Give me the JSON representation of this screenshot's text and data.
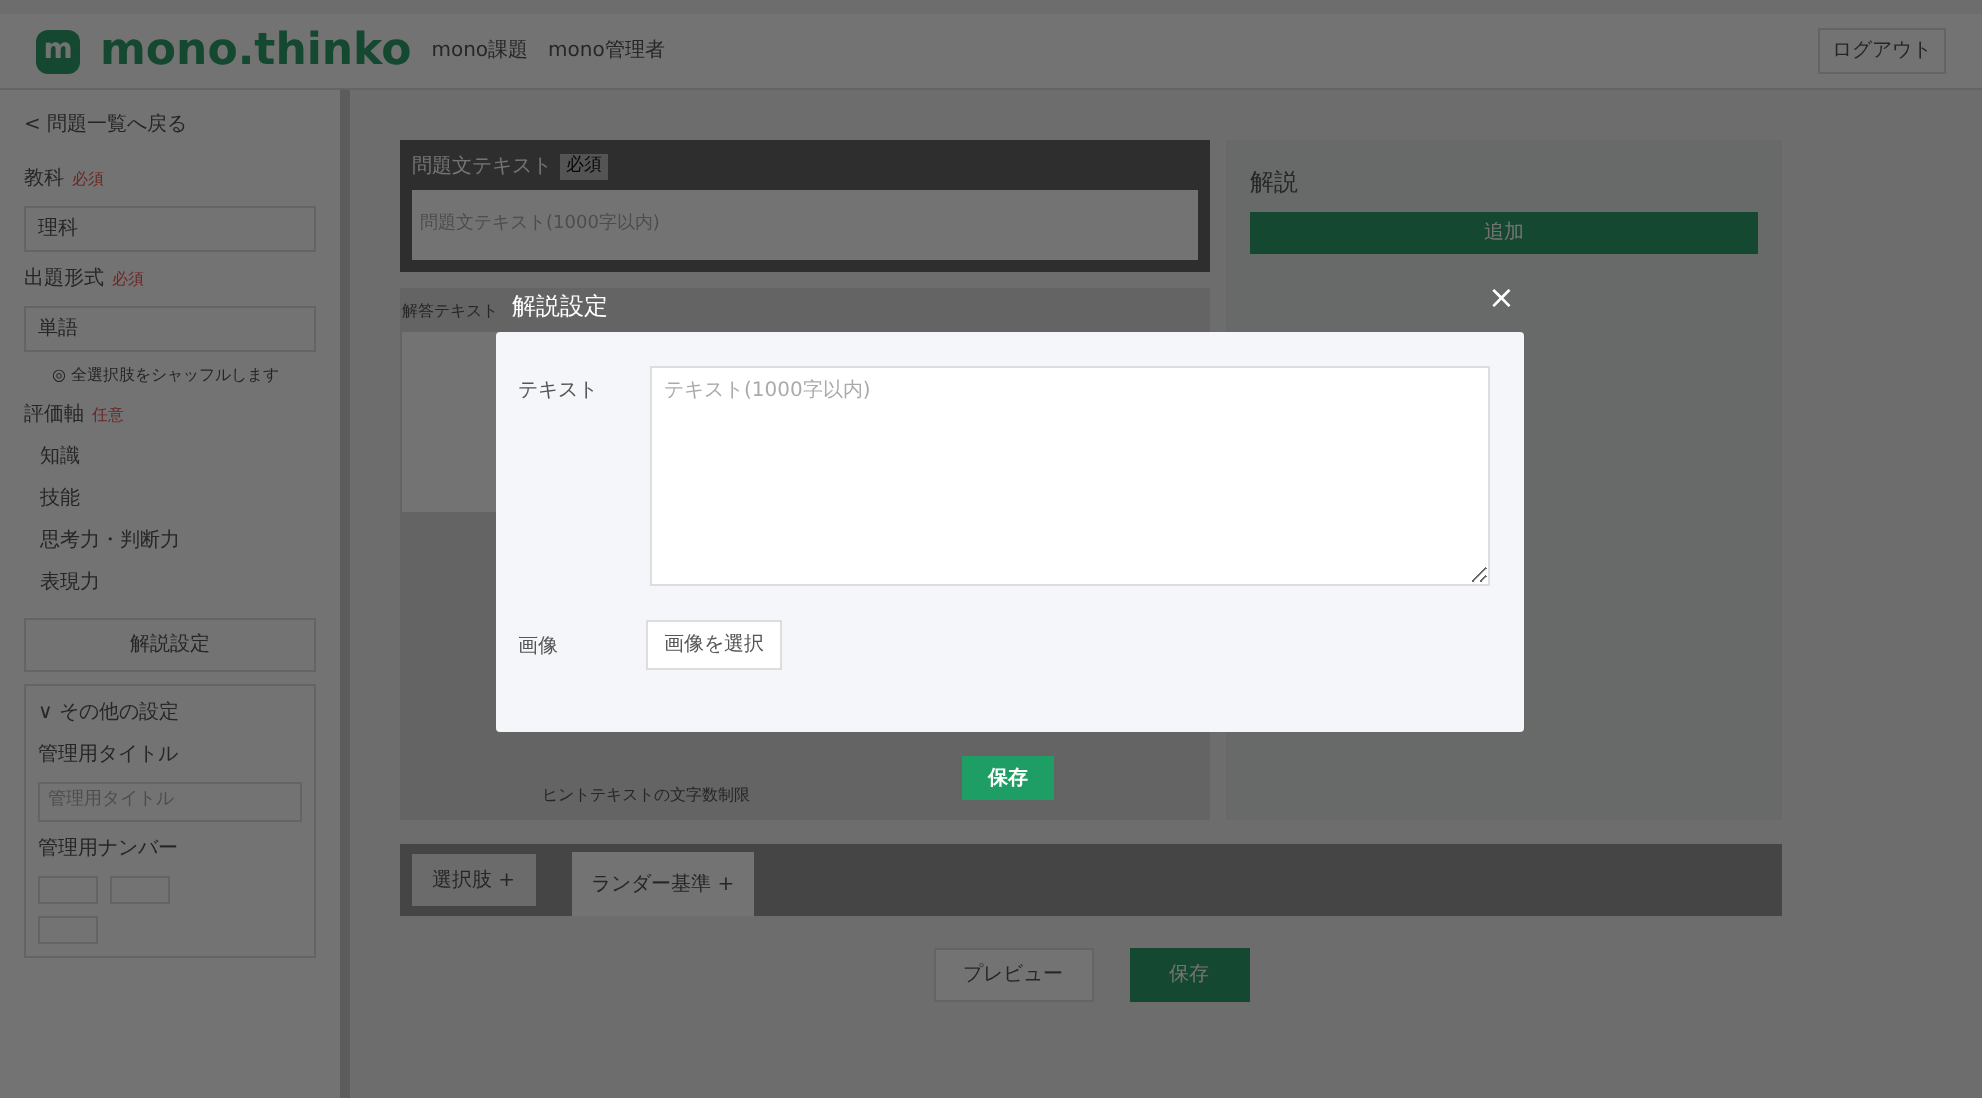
{
  "header": {
    "logo_mark": "m",
    "logo": "mono.thinko",
    "nav": [
      "mono課題",
      "mono管理者"
    ],
    "logout": "ログアウト"
  },
  "sidebar": {
    "back": "< 問題一覧へ戻る",
    "fields": [
      {
        "label": "教科",
        "badge": "必須",
        "value": "理科"
      },
      {
        "label": "出題形式",
        "badge": "必須",
        "value": "単語",
        "note": "◎ 全選択肢をシャッフルします"
      }
    ],
    "axis": {
      "label": "評価軸",
      "badge": "任意",
      "items": [
        "知識",
        "技能",
        "思考力・判断力",
        "表現力"
      ]
    },
    "explain_button": "解説設定",
    "other": {
      "title": "∨ その他の設定",
      "fields": [
        {
          "label": "管理用タイトル",
          "placeholder": "管理用タイトル"
        },
        {
          "label": "管理用ナンバー"
        }
      ]
    }
  },
  "main": {
    "question": {
      "title": "問題文テキスト",
      "badge": "必須",
      "placeholder": "問題文テキスト(1000字以内)"
    },
    "answer": {
      "title": "解答テキスト",
      "caption": "ヒントテキストの文字数制限"
    },
    "side": {
      "title": "解説",
      "add": "追加"
    },
    "tabs": [
      {
        "label": "選択肢 +",
        "selected": false
      },
      {
        "label": "ランダー基準 +",
        "selected": true
      }
    ],
    "preview": "プレビュー",
    "save": "保存"
  },
  "modal": {
    "title": "解説設定",
    "close": "×",
    "text_label": "テキスト",
    "text_placeholder": "テキスト(1000字以内)",
    "image_label": "画像",
    "image_button": "画像を選択",
    "save": "保存"
  }
}
